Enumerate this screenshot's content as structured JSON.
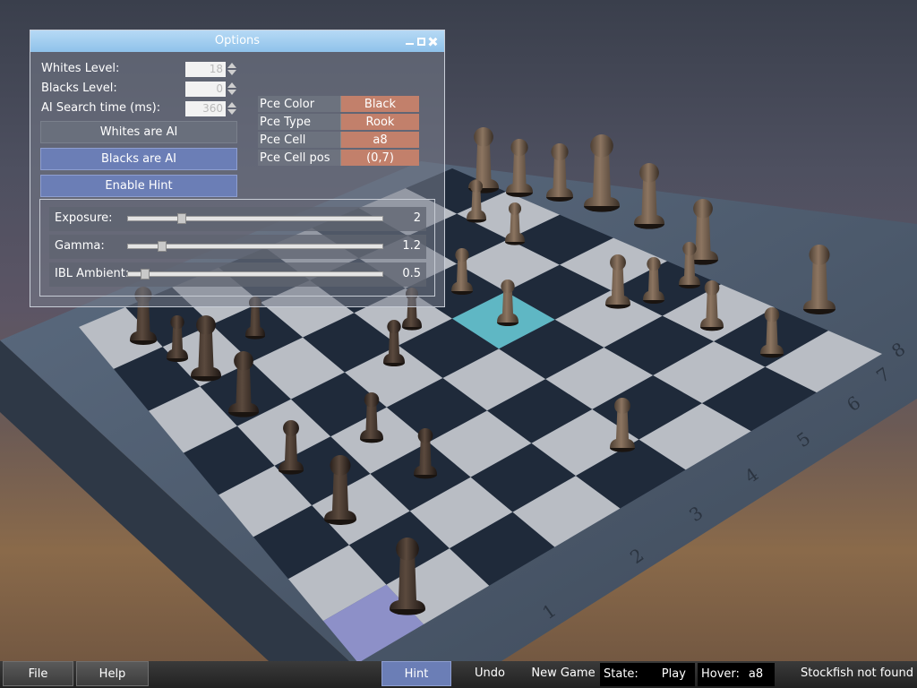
{
  "window": {
    "title": "Options",
    "whites_level": {
      "label": "Whites Level:",
      "value": "18"
    },
    "blacks_level": {
      "label": "Blacks Level:",
      "value": "0"
    },
    "ai_search": {
      "label": "AI Search time (ms):",
      "value": "360"
    },
    "buttons": {
      "whites_ai": "Whites are AI",
      "blacks_ai": "Blacks are AI",
      "enable_hint": "Enable Hint"
    },
    "piece_info": [
      {
        "key": "Pce Color",
        "value": "Black"
      },
      {
        "key": "Pce Type",
        "value": "Rook"
      },
      {
        "key": "Pce Cell",
        "value": "a8"
      },
      {
        "key": "Pce Cell pos",
        "value": "(0,7)"
      }
    ],
    "sliders": [
      {
        "label": "Exposure:",
        "value": "2",
        "fraction": 0.2
      },
      {
        "label": "Gamma:",
        "value": "1.2",
        "fraction": 0.12
      },
      {
        "label": "IBL Ambient:",
        "value": "0.5",
        "fraction": 0.05
      }
    ]
  },
  "bottom_bar": {
    "file": "File",
    "help": "Help",
    "hint": "Hint",
    "undo": "Undo",
    "new_game": "New Game",
    "state_label": "State:",
    "state_value": "Play",
    "hover_label": "Hover:",
    "hover_value": "a8",
    "engine_status": "Stockfish not found"
  },
  "board": {
    "edge_numbers": [
      "1",
      "2",
      "3",
      "4",
      "5",
      "6",
      "7",
      "8"
    ]
  },
  "colors": {
    "title_bar": "#9fcbee",
    "active_button": "#6b7eb6",
    "value_cell": "#c2806b"
  }
}
